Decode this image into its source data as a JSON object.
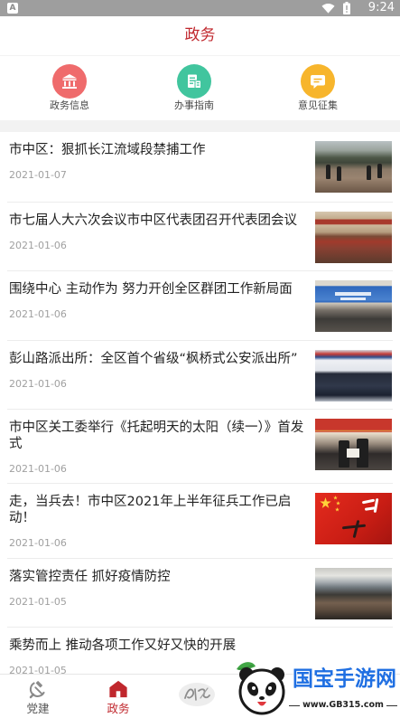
{
  "status_bar": {
    "notification_label": "A",
    "time": "9:24",
    "wifi_icon": "wifi-icon",
    "battery_icon": "battery-icon"
  },
  "header": {
    "title": "政务"
  },
  "quick_links": [
    {
      "label": "政务信息",
      "icon": "bank-icon",
      "color": "#ef6b6c"
    },
    {
      "label": "办事指南",
      "icon": "guide-document-icon",
      "color": "#41c59e"
    },
    {
      "label": "意见征集",
      "icon": "comment-icon",
      "color": "#f7b52c"
    }
  ],
  "news": [
    {
      "title": "市中区：狠抓长江流域段禁捕工作",
      "date": "2021-01-07",
      "has_thumbnail": true
    },
    {
      "title": "市七届人大六次会议市中区代表团召开代表团会议",
      "date": "2021-01-06",
      "has_thumbnail": true
    },
    {
      "title": "围绕中心 主动作为 努力开创全区群团工作新局面",
      "date": "2021-01-06",
      "has_thumbnail": true
    },
    {
      "title": "彭山路派出所：全区首个省级“枫桥式公安派出所”",
      "date": "2021-01-06",
      "has_thumbnail": true
    },
    {
      "title": "市中区关工委举行《托起明天的太阳（续一）》首发式",
      "date": "2021-01-06",
      "has_thumbnail": true
    },
    {
      "title": "走，当兵去！市中区2021年上半年征兵工作已启动！",
      "date": "2021-01-06",
      "has_thumbnail": true
    },
    {
      "title": "落实管控责任 抓好疫情防控",
      "date": "2021-01-05",
      "has_thumbnail": true
    },
    {
      "title": "乘势而上 推动各项工作又好又快的开展",
      "date": "2021-01-05",
      "has_thumbnail": false
    }
  ],
  "tab_bar": {
    "tabs": [
      {
        "label": "党建",
        "icon": "party-emblem-icon",
        "active": false
      },
      {
        "label": "政务",
        "icon": "home-icon",
        "active": true
      },
      {
        "icon": "calligraphy-logo-icon",
        "active": false
      }
    ]
  },
  "watermark": {
    "brand": "国宝手游网",
    "url": "www.GB315.com",
    "icon": "panda-logo-icon"
  },
  "colors": {
    "accent": "#c0272d",
    "status_bar": "#9e9e9e",
    "title_text": "#222222",
    "date_text": "#a0a0a0",
    "section_separator": "#f2f2f2",
    "watermark_brand": "#1f6fe2"
  }
}
